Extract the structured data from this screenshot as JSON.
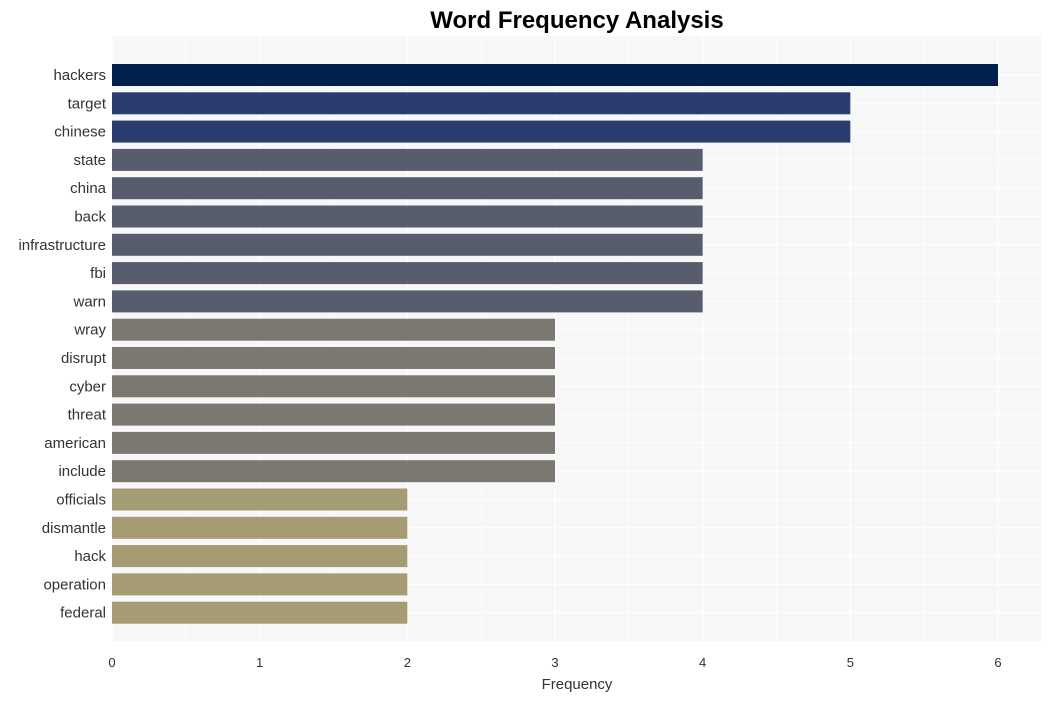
{
  "chart_data": {
    "type": "bar",
    "orientation": "horizontal",
    "title": "Word Frequency Analysis",
    "xlabel": "Frequency",
    "ylabel": "",
    "xlim": [
      0,
      6.3
    ],
    "xticks": [
      0,
      1,
      2,
      3,
      4,
      5,
      6
    ],
    "grid": true,
    "categories": [
      "hackers",
      "target",
      "chinese",
      "state",
      "china",
      "back",
      "infrastructure",
      "fbi",
      "warn",
      "wray",
      "disrupt",
      "cyber",
      "threat",
      "american",
      "include",
      "officials",
      "dismantle",
      "hack",
      "operation",
      "federal"
    ],
    "values": [
      6,
      5,
      5,
      4,
      4,
      4,
      4,
      4,
      4,
      3,
      3,
      3,
      3,
      3,
      3,
      2,
      2,
      2,
      2,
      2
    ],
    "color_by_value": {
      "6": "#00204e",
      "5": "#2a3d6e",
      "4": "#575d6d",
      "3": "#7a7870",
      "2": "#a59c74"
    },
    "panel_background": "#f7f7f7",
    "grid_color": "#ffffff"
  }
}
